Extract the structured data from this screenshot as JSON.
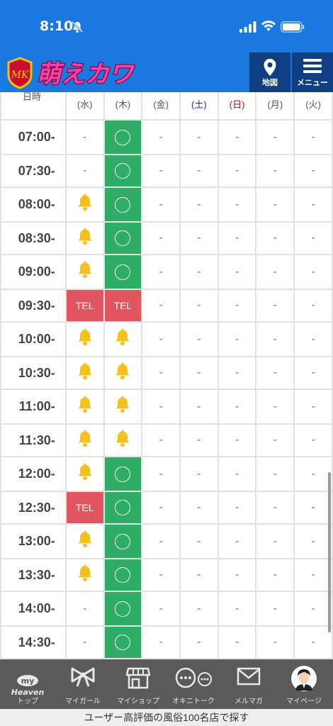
{
  "status_bar": {
    "time": "8:10"
  },
  "header": {
    "logo_text": "萌えカワ",
    "map_label": "地図",
    "menu_label": "メニュー"
  },
  "schedule": {
    "corner_label": "日時",
    "days": [
      {
        "label": "(水)",
        "type": "weekday"
      },
      {
        "label": "(木)",
        "type": "weekday"
      },
      {
        "label": "(金)",
        "type": "weekday"
      },
      {
        "label": "(土)",
        "type": "sat"
      },
      {
        "label": "(日)",
        "type": "sun"
      },
      {
        "label": "(月)",
        "type": "weekday"
      },
      {
        "label": "(火)",
        "type": "weekday"
      }
    ],
    "dash": "-",
    "tel": "TEL",
    "rows": [
      {
        "time": "07:00-",
        "cells": [
          "dash",
          "ok",
          "dash",
          "dash",
          "dash",
          "dash",
          "dash"
        ]
      },
      {
        "time": "07:30-",
        "cells": [
          "dash",
          "ok",
          "dash",
          "dash",
          "dash",
          "dash",
          "dash"
        ]
      },
      {
        "time": "08:00-",
        "cells": [
          "bell",
          "ok",
          "dash",
          "dash",
          "dash",
          "dash",
          "dash"
        ]
      },
      {
        "time": "08:30-",
        "cells": [
          "bell",
          "ok",
          "dash",
          "dash",
          "dash",
          "dash",
          "dash"
        ]
      },
      {
        "time": "09:00-",
        "cells": [
          "bell",
          "ok",
          "dash",
          "dash",
          "dash",
          "dash",
          "dash"
        ]
      },
      {
        "time": "09:30-",
        "cells": [
          "tel",
          "tel",
          "dash",
          "dash",
          "dash",
          "dash",
          "dash"
        ]
      },
      {
        "time": "10:00-",
        "cells": [
          "bell",
          "bell",
          "dash",
          "dash",
          "dash",
          "dash",
          "dash"
        ]
      },
      {
        "time": "10:30-",
        "cells": [
          "bell",
          "bell",
          "dash",
          "dash",
          "dash",
          "dash",
          "dash"
        ]
      },
      {
        "time": "11:00-",
        "cells": [
          "bell",
          "bell",
          "dash",
          "dash",
          "dash",
          "dash",
          "dash"
        ]
      },
      {
        "time": "11:30-",
        "cells": [
          "bell",
          "bell",
          "dash",
          "dash",
          "dash",
          "dash",
          "dash"
        ]
      },
      {
        "time": "12:00-",
        "cells": [
          "bell",
          "ok",
          "dash",
          "dash",
          "dash",
          "dash",
          "dash"
        ]
      },
      {
        "time": "12:30-",
        "cells": [
          "tel",
          "ok",
          "dash",
          "dash",
          "dash",
          "dash",
          "dash"
        ]
      },
      {
        "time": "13:00-",
        "cells": [
          "bell",
          "ok",
          "dash",
          "dash",
          "dash",
          "dash",
          "dash"
        ]
      },
      {
        "time": "13:30-",
        "cells": [
          "bell",
          "ok",
          "dash",
          "dash",
          "dash",
          "dash",
          "dash"
        ]
      },
      {
        "time": "14:00-",
        "cells": [
          "dash",
          "ok",
          "dash",
          "dash",
          "dash",
          "dash",
          "dash"
        ]
      },
      {
        "time": "14:30-",
        "cells": [
          "dash",
          "ok",
          "dash",
          "dash",
          "dash",
          "dash",
          "dash"
        ]
      }
    ]
  },
  "bottom_nav": {
    "items": [
      {
        "label": "トップ",
        "icon": "my-heaven-icon"
      },
      {
        "label": "マイガール",
        "icon": "ribbon-icon"
      },
      {
        "label": "マイショップ",
        "icon": "shop-icon"
      },
      {
        "label": "オキニトーク",
        "icon": "chat-bubbles-icon"
      },
      {
        "label": "メルマガ",
        "icon": "mail-icon"
      },
      {
        "label": "マイページ",
        "icon": "avatar-icon"
      }
    ],
    "logo_my": "my",
    "logo_heaven": "Heaven"
  },
  "banner": {
    "text": "ユーザー高評価の風俗100名店で探す"
  },
  "colors": {
    "header_blue": "#1a78e0",
    "header_button": "#0f3f82",
    "available_green": "#2fac66",
    "tel_red": "#e05560",
    "bell_yellow": "#f6c11c"
  }
}
